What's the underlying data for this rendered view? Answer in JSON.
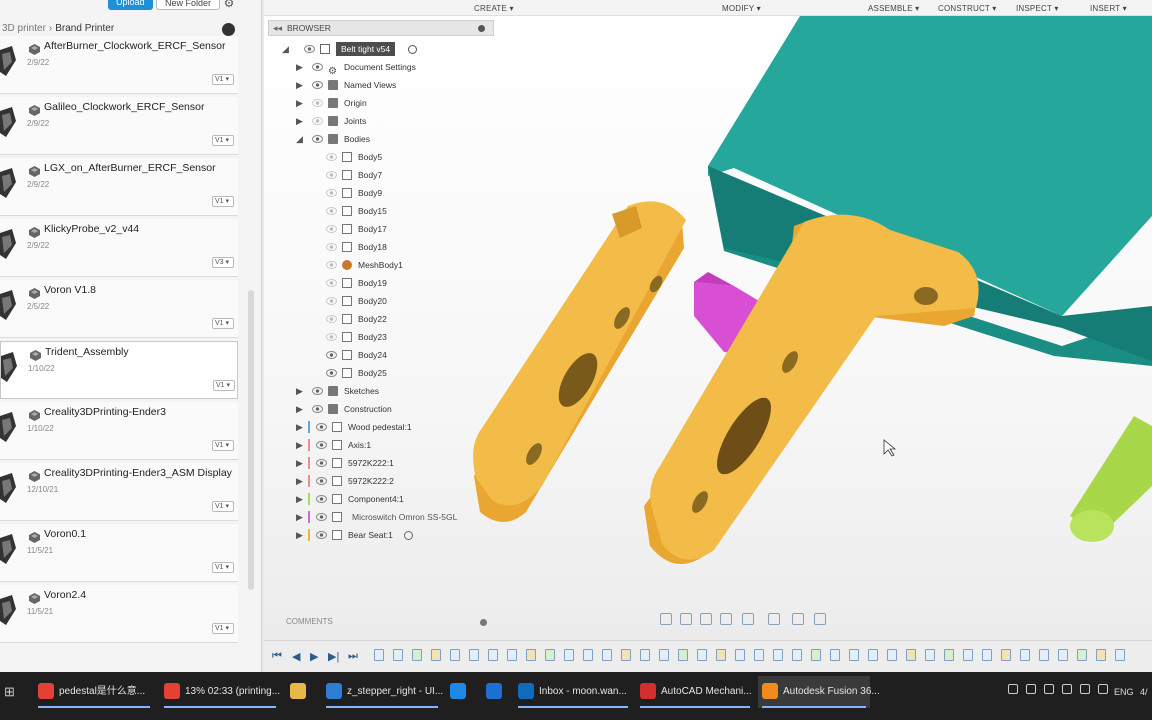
{
  "data_panel": {
    "upload_label": "Upload",
    "new_folder_label": "New Folder",
    "breadcrumb": [
      "3D printer",
      "Brand Printer"
    ],
    "items": [
      {
        "name": "AfterBurner_Clockwork_ERCF_Sensor",
        "date": "2/9/22",
        "version": "V1"
      },
      {
        "name": "Galileo_Clockwork_ERCF_Sensor",
        "date": "2/9/22",
        "version": "V1"
      },
      {
        "name": "LGX_on_AfterBurner_ERCF_Sensor",
        "date": "2/9/22",
        "version": "V1"
      },
      {
        "name": "KlickyProbe_v2_v44",
        "date": "2/9/22",
        "version": "V3"
      },
      {
        "name": "Voron V1.8",
        "date": "2/5/22",
        "version": "V1"
      },
      {
        "name": "Trident_Assembly",
        "date": "1/10/22",
        "version": "V1"
      },
      {
        "name": "Creality3DPrinting-Ender3",
        "date": "1/10/22",
        "version": "V1"
      },
      {
        "name": "Creality3DPrinting-Ender3_ASM Display",
        "date": "12/10/21",
        "version": "V1"
      },
      {
        "name": "Voron0.1",
        "date": "11/5/21",
        "version": "V1"
      },
      {
        "name": "Voron2.4",
        "date": "11/5/21",
        "version": "V1"
      }
    ]
  },
  "toolbar": {
    "create": "CREATE ▾",
    "modify": "MODIFY ▾",
    "assemble": "ASSEMBLE ▾",
    "construct": "CONSTRUCT ▾",
    "inspect": "INSPECT ▾",
    "insert": "INSERT ▾"
  },
  "browser": {
    "title": "BROWSER",
    "root": "Belt tight v54",
    "nodes": [
      {
        "label": "Document Settings",
        "indent": 1,
        "arrow": "▶"
      },
      {
        "label": "Named Views",
        "indent": 1,
        "arrow": "▶"
      },
      {
        "label": "Origin",
        "indent": 1,
        "arrow": "▶"
      },
      {
        "label": "Joints",
        "indent": 1,
        "arrow": "▶"
      },
      {
        "label": "Bodies",
        "indent": 1,
        "arrow": "◢"
      },
      {
        "label": "Body5",
        "indent": 2,
        "arrow": ""
      },
      {
        "label": "Body7",
        "indent": 2,
        "arrow": ""
      },
      {
        "label": "Body9",
        "indent": 2,
        "arrow": ""
      },
      {
        "label": "Body15",
        "indent": 2,
        "arrow": ""
      },
      {
        "label": "Body17",
        "indent": 2,
        "arrow": ""
      },
      {
        "label": "Body18",
        "indent": 2,
        "arrow": ""
      },
      {
        "label": "MeshBody1",
        "indent": 2,
        "arrow": ""
      },
      {
        "label": "Body19",
        "indent": 2,
        "arrow": ""
      },
      {
        "label": "Body20",
        "indent": 2,
        "arrow": ""
      },
      {
        "label": "Body22",
        "indent": 2,
        "arrow": ""
      },
      {
        "label": "Body23",
        "indent": 2,
        "arrow": ""
      },
      {
        "label": "Body24",
        "indent": 2,
        "arrow": ""
      },
      {
        "label": "Body25",
        "indent": 2,
        "arrow": ""
      },
      {
        "label": "Sketches",
        "indent": 1,
        "arrow": "▶"
      },
      {
        "label": "Construction",
        "indent": 1,
        "arrow": "▶"
      },
      {
        "label": "Wood pedestal:1",
        "indent": 1,
        "arrow": "▶"
      },
      {
        "label": "Axis:1",
        "indent": 1,
        "arrow": "▶"
      },
      {
        "label": "5972K222:1",
        "indent": 1,
        "arrow": "▶"
      },
      {
        "label": "5972K222:2",
        "indent": 1,
        "arrow": "▶"
      },
      {
        "label": "Component4:1",
        "indent": 1,
        "arrow": "▶"
      },
      {
        "label": "Microswitch Omron SS-5GL",
        "indent": 1,
        "arrow": "▶"
      },
      {
        "label": "Bear Seat:1",
        "indent": 1,
        "arrow": "▶"
      }
    ]
  },
  "comments_label": "COMMENTS",
  "taskbar": {
    "items": [
      {
        "label": "pedestal是什么意...",
        "color": "#e34133"
      },
      {
        "label": "13% 02:33 (printing...",
        "color": "#e34133"
      },
      {
        "label": "",
        "color": "#e8b84a"
      },
      {
        "label": "z_stepper_right - UI...",
        "color": "#2d7dd2"
      },
      {
        "label": "",
        "color": "#1e88e5"
      },
      {
        "label": "",
        "color": "#1d6fd1"
      },
      {
        "label": "Inbox - moon.wan...",
        "color": "#0f6cbd"
      },
      {
        "label": "AutoCAD Mechani...",
        "color": "#d32f2f"
      },
      {
        "label": "Autodesk Fusion 36...",
        "color": "#f08c1e"
      }
    ],
    "lang": "ENG",
    "time": "4/"
  },
  "colors": {
    "body_orange": "#f0b43c",
    "pedestal_teal": "#1fa39a",
    "magenta": "#d63fd1",
    "lime": "#a8d84a"
  }
}
